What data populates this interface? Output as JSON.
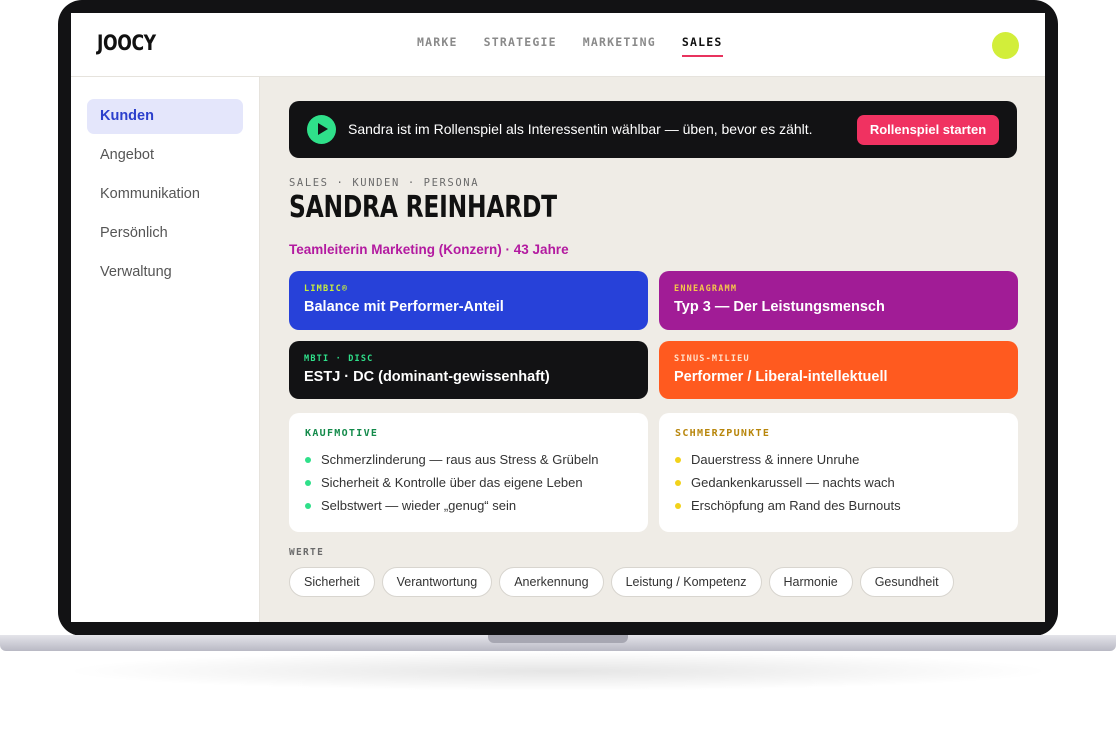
{
  "app": {
    "logo": "JOOCY"
  },
  "nav": [
    {
      "label": "MARKE",
      "active": false
    },
    {
      "label": "STRATEGIE",
      "active": false
    },
    {
      "label": "MARKETING",
      "active": false
    },
    {
      "label": "SALES",
      "active": true
    }
  ],
  "sidebar": {
    "items": [
      {
        "label": "Kunden",
        "active": true
      },
      {
        "label": "Angebot",
        "active": false
      },
      {
        "label": "Kommunikation",
        "active": false
      },
      {
        "label": "Persönlich",
        "active": false
      },
      {
        "label": "Verwaltung",
        "active": false
      }
    ]
  },
  "banner": {
    "text": "Sandra ist im Rollenspiel als Interessentin wählbar — üben, bevor es zählt.",
    "button": "Rollenspiel starten"
  },
  "persona": {
    "breadcrumb": "SALES · KUNDEN · PERSONA",
    "name": "SANDRA REINHARDT",
    "role": "Teamleiterin Marketing (Konzern) · 43 Jahre"
  },
  "profiles": [
    {
      "key": "LIMBIC®",
      "value": "Balance mit Performer-Anteil"
    },
    {
      "key": "ENNEAGRAMM",
      "value": "Typ 3 — Der Leistungsmensch"
    },
    {
      "key": "MBTI · DISC",
      "value": "ESTJ · DC (dominant-gewissenhaft)"
    },
    {
      "key": "SINUS-MILIEU",
      "value": "Performer / Liberal-intellektuell"
    }
  ],
  "kaufmotive": {
    "title": "KAUFMOTIVE",
    "items": [
      "Schmerzlinderung — raus aus Stress & Grübeln",
      "Sicherheit & Kontrolle über das eigene Leben",
      "Selbstwert — wieder „genug“ sein"
    ]
  },
  "schmerzpunkte": {
    "title": "SCHMERZPUNKTE",
    "items": [
      "Dauerstress & innere Unruhe",
      "Gedankenkarussell — nachts wach",
      "Erschöpfung am Rand des Burnouts"
    ]
  },
  "werte": {
    "title": "WERTE",
    "chips": [
      "Sicherheit",
      "Verantwortung",
      "Anerkennung",
      "Leistung / Kompetenz",
      "Harmonie",
      "Gesundheit"
    ]
  },
  "colors": {
    "accent_pink": "#f03261",
    "play_green": "#2fe08a",
    "avatar_lime": "#d2ee3a",
    "limbic_blue": "#2741d9",
    "enneagramm_purple": "#a11c96",
    "sinus_orange": "#ff5a1f"
  }
}
